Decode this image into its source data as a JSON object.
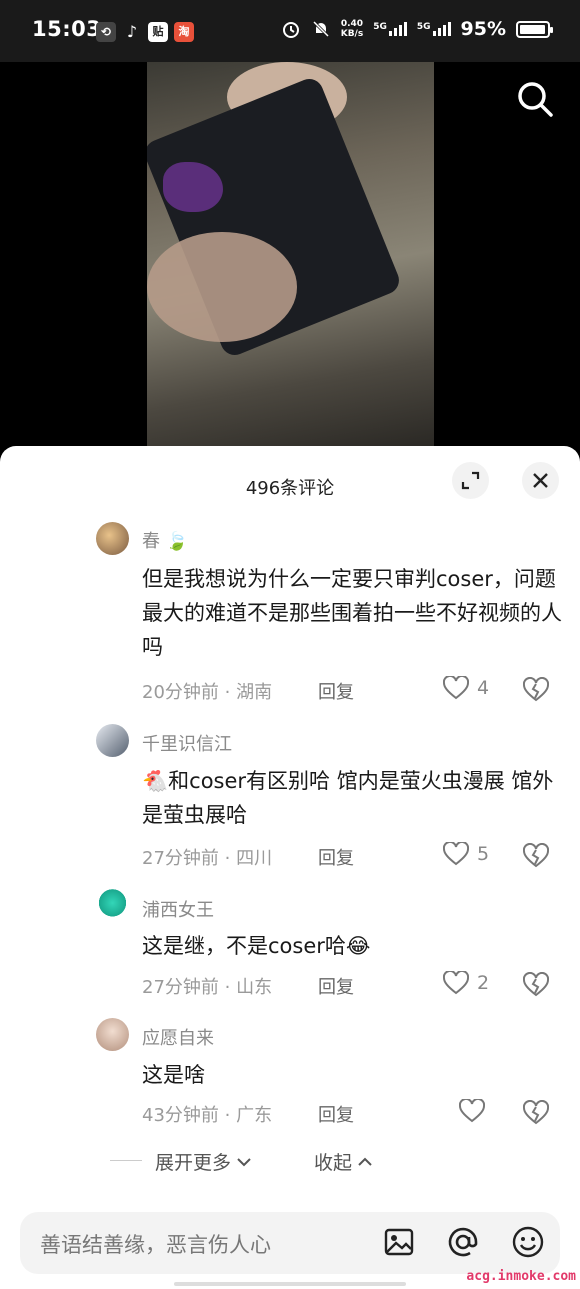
{
  "status_bar": {
    "time": "15:03",
    "app_icons": [
      "sync-icon",
      "tiktok-icon",
      "tieba-icon",
      "taobao-icon"
    ],
    "net_speed_value": "0.40",
    "net_speed_unit": "KB/s",
    "net_type_1": "5G",
    "net_type_2": "5G",
    "battery_percent": "95%",
    "battery_level": 0.95
  },
  "comments_panel": {
    "title": "496条评论",
    "comments": [
      {
        "user": "春",
        "text": "但是我想说为什么一定要只审判coser，问题最大的难道不是那些围着拍一些不好视频的人吗",
        "time_location": "20分钟前 · 湖南",
        "reply_label": "回复",
        "likes": "4"
      },
      {
        "user": "千里识信江",
        "text": "🐔和coser有区别哈  馆内是萤火虫漫展  馆外是萤虫展哈",
        "time_location": "27分钟前 · 四川",
        "reply_label": "回复",
        "likes": "5"
      },
      {
        "user": "浦西女王",
        "text": "这是继，不是coser哈😂",
        "time_location": "27分钟前 · 山东",
        "reply_label": "回复",
        "likes": "2"
      },
      {
        "user": "应愿自来",
        "text": "这是啥",
        "time_location": "43分钟前 · 广东",
        "reply_label": "回复",
        "likes": ""
      }
    ],
    "expand_more": "展开更多",
    "collapse": "收起"
  },
  "input_bar": {
    "placeholder": "善语结善缘，恶言伤人心"
  },
  "watermark": "acg.inmoke.com",
  "colors": {
    "accent_watermark": "#e23a6a",
    "muted_text": "#9a9a9a"
  }
}
